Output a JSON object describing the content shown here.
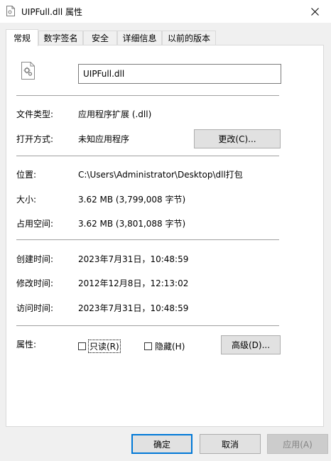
{
  "window": {
    "title": "UIPFull.dll 属性",
    "title_icon": "document-icon",
    "close_icon": "close-icon"
  },
  "tabs": [
    {
      "label": "常规",
      "active": true
    },
    {
      "label": "数字签名",
      "active": false
    },
    {
      "label": "安全",
      "active": false
    },
    {
      "label": "详细信息",
      "active": false
    },
    {
      "label": "以前的版本",
      "active": false
    }
  ],
  "general": {
    "file_icon": "dll-gear-file-icon",
    "filename": "UIPFull.dll",
    "type_label": "文件类型:",
    "type_value": "应用程序扩展 (.dll)",
    "opens_label": "打开方式:",
    "opens_value": "未知应用程序",
    "change_button": "更改(C)...",
    "location_label": "位置:",
    "location_value": "C:\\Users\\Administrator\\Desktop\\dll打包",
    "size_label": "大小:",
    "size_value": "3.62 MB (3,799,008 字节)",
    "disk_label": "占用空间:",
    "disk_value": "3.62 MB (3,801,088 字节)",
    "created_label": "创建时间:",
    "created_value": "2023年7月31日，10:48:59",
    "modified_label": "修改时间:",
    "modified_value": "2012年12月8日，12:13:02",
    "accessed_label": "访问时间:",
    "accessed_value": "2023年7月31日，10:48:59",
    "attributes_label": "属性:",
    "readonly_label": "只读(R)",
    "readonly_checked": false,
    "hidden_label": "隐藏(H)",
    "hidden_checked": false,
    "advanced_button": "高级(D)..."
  },
  "footer": {
    "ok": "确定",
    "cancel": "取消",
    "apply": "应用(A)"
  },
  "colors": {
    "accent": "#0078d7",
    "window_bg": "#f0f0f0",
    "panel_bg": "#ffffff",
    "separator": "#a0a0a0"
  }
}
